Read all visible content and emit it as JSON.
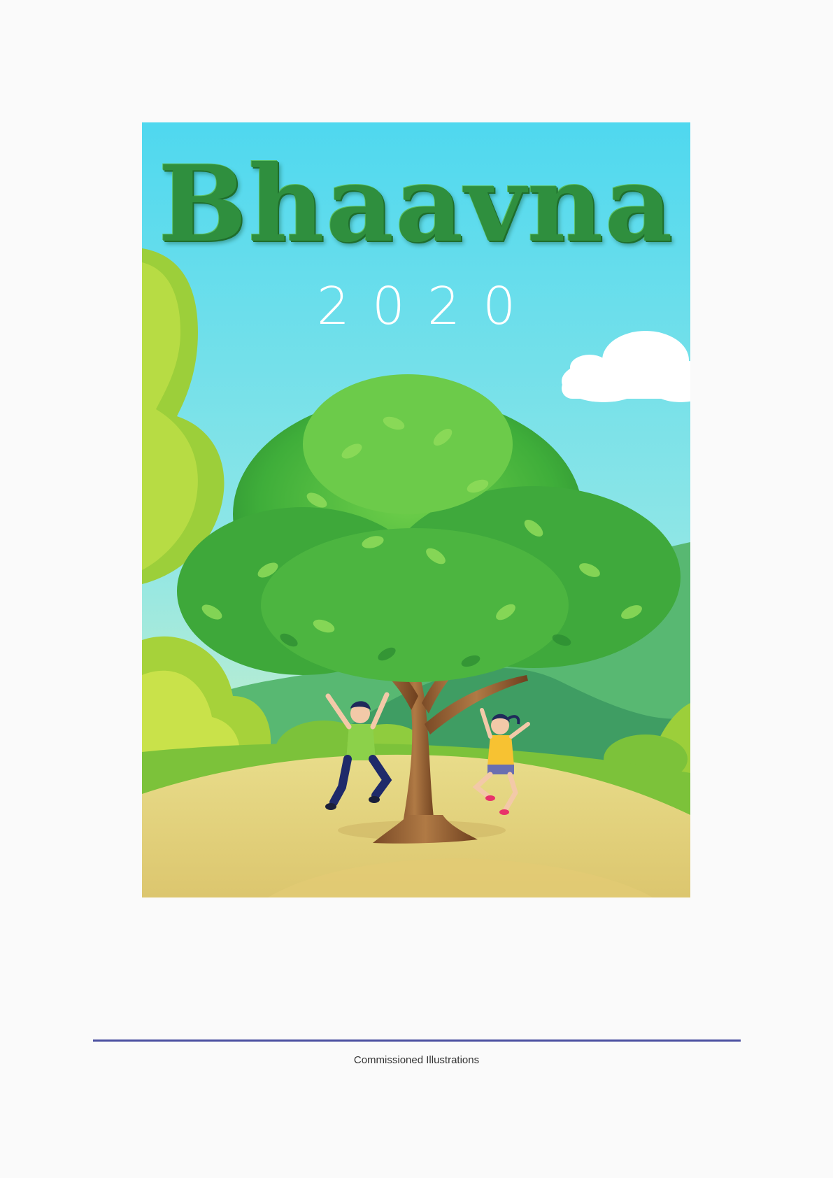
{
  "cover": {
    "title": "Bhaavna",
    "year": "2020"
  },
  "footer": {
    "caption": "Commissioned Illustrations"
  },
  "colors": {
    "page_background": "#fafafa",
    "sky_top": "#4fd8ef",
    "sky_bottom": "#bfeecf",
    "title_green": "#2f8f3e",
    "rule_blue": "#4a4fa0"
  }
}
